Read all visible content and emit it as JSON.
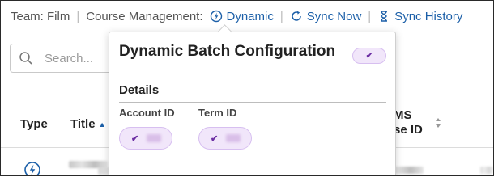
{
  "topbar": {
    "team": "Team: Film",
    "course_management": "Course Management:",
    "dynamic": "Dynamic",
    "sync_now": "Sync Now",
    "sync_history": "Sync History",
    "separator": "|"
  },
  "search": {
    "placeholder": "Search..."
  },
  "table": {
    "headers": {
      "type": "Type",
      "title": "Title",
      "sis_line1": "MS",
      "sis_line2": "se ID"
    }
  },
  "popover": {
    "title": "Dynamic Batch Configuration",
    "section": "Details",
    "fields": [
      {
        "label": "Account ID"
      },
      {
        "label": "Term ID"
      }
    ]
  },
  "colors": {
    "link": "#1b5fa8",
    "badge_bg": "#f1e6fa",
    "badge_check": "#6c2ea3"
  }
}
